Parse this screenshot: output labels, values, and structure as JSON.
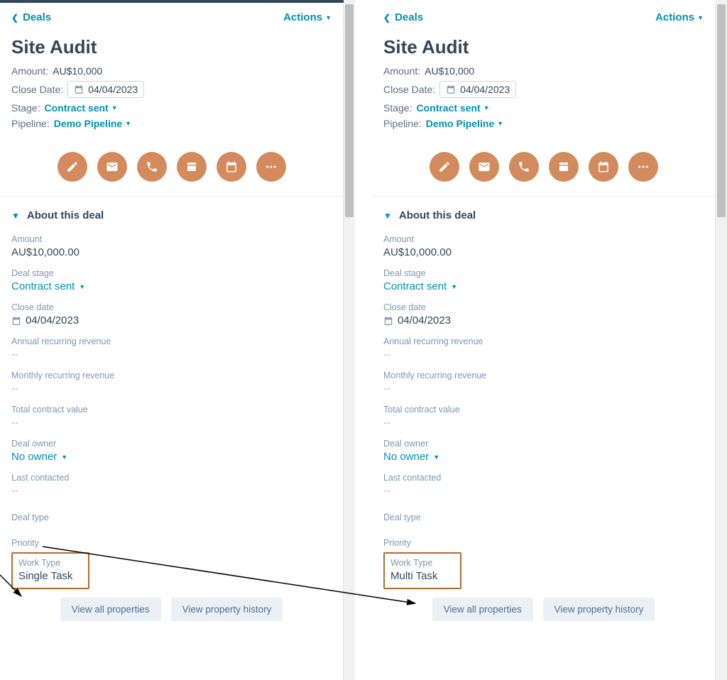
{
  "panes": [
    {
      "back_label": "Deals",
      "actions_label": "Actions",
      "title": "Site Audit",
      "amount_label": "Amount:",
      "amount_value": "AU$10,000",
      "close_date_label": "Close Date:",
      "close_date_value": "04/04/2023",
      "stage_label": "Stage:",
      "stage_value": "Contract sent",
      "pipeline_label": "Pipeline:",
      "pipeline_value": "Demo Pipeline",
      "section_title": "About this deal",
      "props": {
        "amount_label": "Amount",
        "amount_value": "AU$10,000.00",
        "deal_stage_label": "Deal stage",
        "deal_stage_value": "Contract sent",
        "close_date_label": "Close date",
        "close_date_value": "04/04/2023",
        "arr_label": "Annual recurring revenue",
        "arr_value": "--",
        "mrr_label": "Monthly recurring revenue",
        "mrr_value": "--",
        "tcv_label": "Total contract value",
        "tcv_value": "--",
        "owner_label": "Deal owner",
        "owner_value": "No owner",
        "last_contacted_label": "Last contacted",
        "last_contacted_value": "--",
        "deal_type_label": "Deal type",
        "priority_label": "Priority",
        "work_type_label": "Work Type",
        "work_type_value": "Single Task"
      },
      "view_all_btn": "View all properties",
      "view_history_btn": "View property history"
    },
    {
      "back_label": "Deals",
      "actions_label": "Actions",
      "title": "Site Audit",
      "amount_label": "Amount:",
      "amount_value": "AU$10,000",
      "close_date_label": "Close Date:",
      "close_date_value": "04/04/2023",
      "stage_label": "Stage:",
      "stage_value": "Contract sent",
      "pipeline_label": "Pipeline:",
      "pipeline_value": "Demo Pipeline",
      "section_title": "About this deal",
      "props": {
        "amount_label": "Amount",
        "amount_value": "AU$10,000.00",
        "deal_stage_label": "Deal stage",
        "deal_stage_value": "Contract sent",
        "close_date_label": "Close date",
        "close_date_value": "04/04/2023",
        "arr_label": "Annual recurring revenue",
        "arr_value": "--",
        "mrr_label": "Monthly recurring revenue",
        "mrr_value": "--",
        "tcv_label": "Total contract value",
        "tcv_value": "--",
        "owner_label": "Deal owner",
        "owner_value": "No owner",
        "last_contacted_label": "Last contacted",
        "last_contacted_value": "--",
        "deal_type_label": "Deal type",
        "priority_label": "Priority",
        "work_type_label": "Work Type",
        "work_type_value": "Multi Task"
      },
      "view_all_btn": "View all properties",
      "view_history_btn": "View property history"
    }
  ],
  "icons": {
    "note": "note-icon",
    "email": "email-icon",
    "call": "call-icon",
    "log": "log-icon",
    "task": "task-icon",
    "more": "more-icon"
  }
}
